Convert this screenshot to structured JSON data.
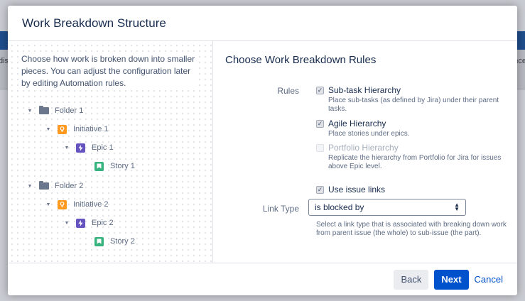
{
  "background": {
    "left_fragment": "dis",
    "right_fragment": "nce"
  },
  "modal": {
    "title": "Work Breakdown Structure",
    "intro": "Choose how work is broken down into smaller pieces. You can adjust the configuration later by editing Automation rules.",
    "tree": [
      {
        "label": "Folder 1",
        "type": "folder",
        "icon": "folder-icon",
        "level": 0
      },
      {
        "label": "Initiative 1",
        "type": "initiative",
        "icon": "initiative-icon",
        "level": 1
      },
      {
        "label": "Epic 1",
        "type": "epic",
        "icon": "epic-icon",
        "level": 2
      },
      {
        "label": "Story 1",
        "type": "story",
        "icon": "story-icon",
        "level": 3
      },
      {
        "label": "Folder 2",
        "type": "folder",
        "icon": "folder-icon",
        "level": 0
      },
      {
        "label": "Initiative 2",
        "type": "initiative",
        "icon": "initiative-icon",
        "level": 1
      },
      {
        "label": "Epic 2",
        "type": "epic",
        "icon": "epic-icon",
        "level": 2
      },
      {
        "label": "Story 2",
        "type": "story",
        "icon": "story-icon",
        "level": 3
      }
    ],
    "rules_panel": {
      "title": "Choose Work Breakdown Rules",
      "rules_label": "Rules",
      "options": [
        {
          "label": "Sub-task Hierarchy",
          "description": "Place sub-tasks (as defined by Jira) under their parent tasks.",
          "checked": true,
          "disabled": false
        },
        {
          "label": "Agile Hierarchy",
          "description": "Place stories under epics.",
          "checked": true,
          "disabled": false
        },
        {
          "label": "Portfolio Hierarchy",
          "description": "Replicate the hierarchy from Portfolio for Jira for issues above Epic level.",
          "checked": false,
          "disabled": true
        }
      ],
      "use_issue_links": {
        "label": "Use issue links",
        "checked": true
      },
      "link_type_label": "Link Type",
      "link_type_value": "is blocked by",
      "link_type_help": "Select a link type that is associated with breaking down work from parent issue (the whole) to sub-issue (the part)."
    },
    "footer": {
      "back": "Back",
      "next": "Next",
      "cancel": "Cancel"
    }
  },
  "colors": {
    "primary": "#0052cc",
    "initiative": "#ff991f",
    "epic": "#6554c0",
    "story": "#36b37e"
  }
}
